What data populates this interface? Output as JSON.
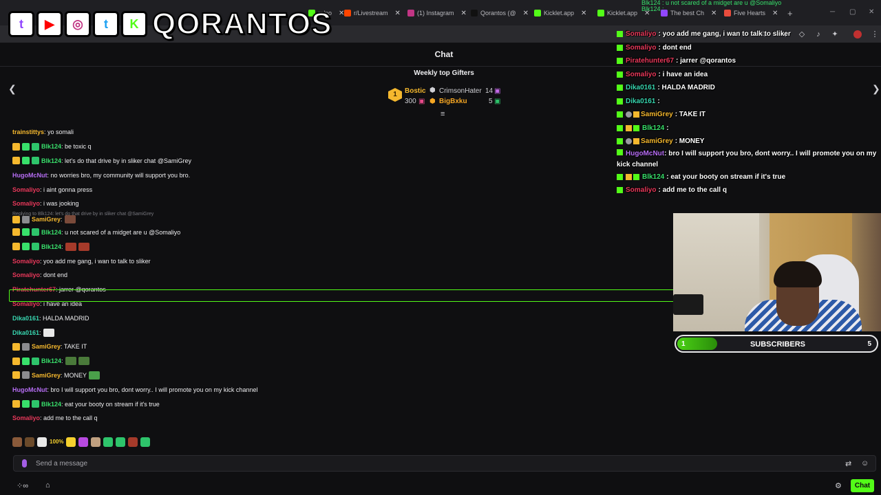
{
  "browser": {
    "tabs": [
      {
        "label": "m/po",
        "color": "#53fc18"
      },
      {
        "label": "r/Livestream",
        "color": "#ff4500"
      },
      {
        "label": "(1) Instagram",
        "color": "#c13584"
      },
      {
        "label": "Qorantos (@",
        "color": "#111111"
      },
      {
        "label": "Kicklet.app",
        "color": "#53fc18"
      },
      {
        "label": "Kicklet.app",
        "color": "#53fc18"
      },
      {
        "label": "The best Ch",
        "color": "#9146ff"
      },
      {
        "label": "Five Hearts",
        "color": "#e84c3d"
      }
    ],
    "new_tab": "+",
    "close_glyph": "✕"
  },
  "brand": {
    "icons": [
      {
        "name": "twitch-icon",
        "glyph": "t",
        "color": "#9146ff"
      },
      {
        "name": "youtube-icon",
        "glyph": "▶",
        "color": "#ff0000"
      },
      {
        "name": "instagram-icon",
        "glyph": "◎",
        "color": "#c13584"
      },
      {
        "name": "twitter-icon",
        "glyph": "t",
        "color": "#1da1f2"
      },
      {
        "name": "kick-icon",
        "glyph": "K",
        "color": "#53fc18"
      }
    ],
    "name": "QORANTOS"
  },
  "chat": {
    "title": "Chat",
    "weekly_top_gifters": "Weekly top Gifters",
    "gifters": [
      {
        "rank": "1",
        "name": "Bostic",
        "count": "300",
        "color": "#f5b82e"
      },
      {
        "name": "CrimsonHater",
        "count": "14",
        "color": "#b0b0b5"
      },
      {
        "name": "BigBxku",
        "count": "5",
        "color": "#f5a623"
      }
    ],
    "reply_note": "Replying to Blk124: let's do that drive by in sliker chat @SamiGrey",
    "messages": [
      {
        "badges": [],
        "user": "trainstittys",
        "color": "#f5b82e",
        "text": ": yo somali",
        "emotes": []
      },
      {
        "badges": [
          "crown",
          "green",
          "gift"
        ],
        "user": "Blk124",
        "color": "#38e06b",
        "text": ": be toxic q",
        "emotes": []
      },
      {
        "badges": [
          "crown",
          "green",
          "gift"
        ],
        "user": "Blk124",
        "color": "#38e06b",
        "text": ": let's do that drive by in sliker chat @SamiGrey",
        "emotes": []
      },
      {
        "badges": [],
        "user": "HugoMcNut",
        "color": "#b76ef5",
        "text": ": no worries bro, my community will support you bro.",
        "emotes": []
      },
      {
        "badges": [],
        "user": "Somaliyo",
        "color": "#e8385a",
        "text": ": i aint gonna press",
        "emotes": []
      },
      {
        "badges": [],
        "user": "Somaliyo",
        "color": "#e8385a",
        "text": ": i was jooking",
        "emotes": []
      },
      {
        "badges": [
          "crown",
          "gear"
        ],
        "user": "SamiGrey",
        "color": "#f5b82e",
        "text": ":",
        "emotes": [
          "#7a4a3a"
        ],
        "reply": true
      },
      {
        "badges": [
          "crown",
          "green",
          "gift"
        ],
        "user": "Blk124",
        "color": "#38e06b",
        "text": ": u not scared of a midget are u @Somaliyo",
        "emotes": []
      },
      {
        "badges": [
          "crown",
          "green",
          "gift"
        ],
        "user": "Blk124",
        "color": "#38e06b",
        "text": ":",
        "emotes": [
          "#a53a2a",
          "#a53a2a"
        ]
      },
      {
        "badges": [],
        "user": "Somaliyo",
        "color": "#e8385a",
        "text": ": yoo add me gang, i wan to talk to sliker",
        "emotes": []
      },
      {
        "badges": [],
        "user": "Somaliyo",
        "color": "#e8385a",
        "text": ": dont end",
        "emotes": []
      },
      {
        "badges": [],
        "user": "Piratehunter67",
        "color": "#e8385a",
        "text": ": jarrer @qorantos",
        "emotes": []
      },
      {
        "badges": [],
        "user": "Somaliyo",
        "color": "#e8385a",
        "text": ": i have an idea",
        "emotes": []
      },
      {
        "badges": [],
        "user": "Dika0161",
        "color": "#38d6b0",
        "text": ": HALDA MADRID",
        "emotes": []
      },
      {
        "badges": [],
        "user": "Dika0161",
        "color": "#38d6b0",
        "text": ":",
        "emotes": [
          "#e8e8e8"
        ]
      },
      {
        "badges": [
          "crown",
          "gear"
        ],
        "user": "SamiGrey",
        "color": "#f5b82e",
        "text": ": TAKE IT",
        "emotes": []
      },
      {
        "badges": [
          "crown",
          "green",
          "gift"
        ],
        "user": "Blk124",
        "color": "#38e06b",
        "text": ":",
        "emotes": [
          "#4a7a3a",
          "#4a7a3a"
        ]
      },
      {
        "badges": [
          "crown",
          "gear"
        ],
        "user": "SamiGrey",
        "color": "#f5b82e",
        "text": ": MONEY",
        "emotes": [
          "#4aa04a"
        ]
      },
      {
        "badges": [],
        "user": "HugoMcNut",
        "color": "#b76ef5",
        "text": ": bro I will support you bro, dont worry.. I will promote you on my kick channel",
        "emotes": []
      },
      {
        "badges": [
          "crown",
          "green",
          "gift"
        ],
        "user": "Blk124",
        "color": "#38e06b",
        "text": ": eat your booty on stream if it's true",
        "emotes": []
      },
      {
        "badges": [],
        "user": "Somaliyo",
        "color": "#e8385a",
        "text": ": add me to the call q",
        "emotes": []
      }
    ],
    "emote_bar": [
      "#8a5a3a",
      "#6b4a2a",
      "#e8e8e8",
      "#f5d02e",
      "#b84ae0",
      "#c0a080",
      "#2ec46b",
      "#2ec46b",
      "#a53a2a",
      "#2ec46b"
    ],
    "emote_bar_text": "100%",
    "input_placeholder": "Send a message",
    "chat_button": "Chat"
  },
  "overlay": {
    "top_lines": [
      "Blk124 : u not scared of a midget are u @Somaliyo",
      "Blk124 :"
    ],
    "lines": [
      {
        "user": "Somaliyo",
        "color": "#e8385a",
        "text": ": yoo add me gang, i wan to talk to sliker",
        "badges": []
      },
      {
        "user": "Somaliyo",
        "color": "#e8385a",
        "text": ": dont end",
        "badges": []
      },
      {
        "user": "Piratehunter67",
        "color": "#e8385a",
        "text": ": jarrer @qorantos",
        "badges": []
      },
      {
        "user": "Somaliyo",
        "color": "#e8385a",
        "text": ": i have an idea",
        "badges": []
      },
      {
        "user": "Dika0161",
        "color": "#38d6b0",
        "text": ": HALDA MADRID",
        "badges": []
      },
      {
        "user": "Dika0161",
        "color": "#38d6b0",
        "text": ":",
        "badges": []
      },
      {
        "user": "SamiGrey",
        "color": "#f5b82e",
        "text": ": TAKE IT",
        "badges": [
          "gear",
          "crown"
        ]
      },
      {
        "user": "Blk124",
        "color": "#38e06b",
        "text": ":",
        "badges": [
          "crown",
          "green"
        ]
      },
      {
        "user": "SamiGrey",
        "color": "#f5b82e",
        "text": ": MONEY",
        "badges": [
          "gear",
          "crown"
        ]
      }
    ],
    "wrap_user": "HugoMcNut",
    "wrap_color": "#b76ef5",
    "wrap_text": ": bro I will support you bro, dont worry.. I will promote you on my kick channel",
    "after_lines": [
      {
        "user": "Blk124",
        "color": "#38e06b",
        "text": ": eat your booty on stream if it's true",
        "badges": [
          "crown",
          "green"
        ]
      },
      {
        "user": "Somaliyo",
        "color": "#e8385a",
        "text": ": add me to the call q",
        "badges": []
      }
    ]
  },
  "subs_goal": {
    "label": "SUBSCRIBERS",
    "current": "1",
    "goal": "5",
    "progress": 0.2
  }
}
